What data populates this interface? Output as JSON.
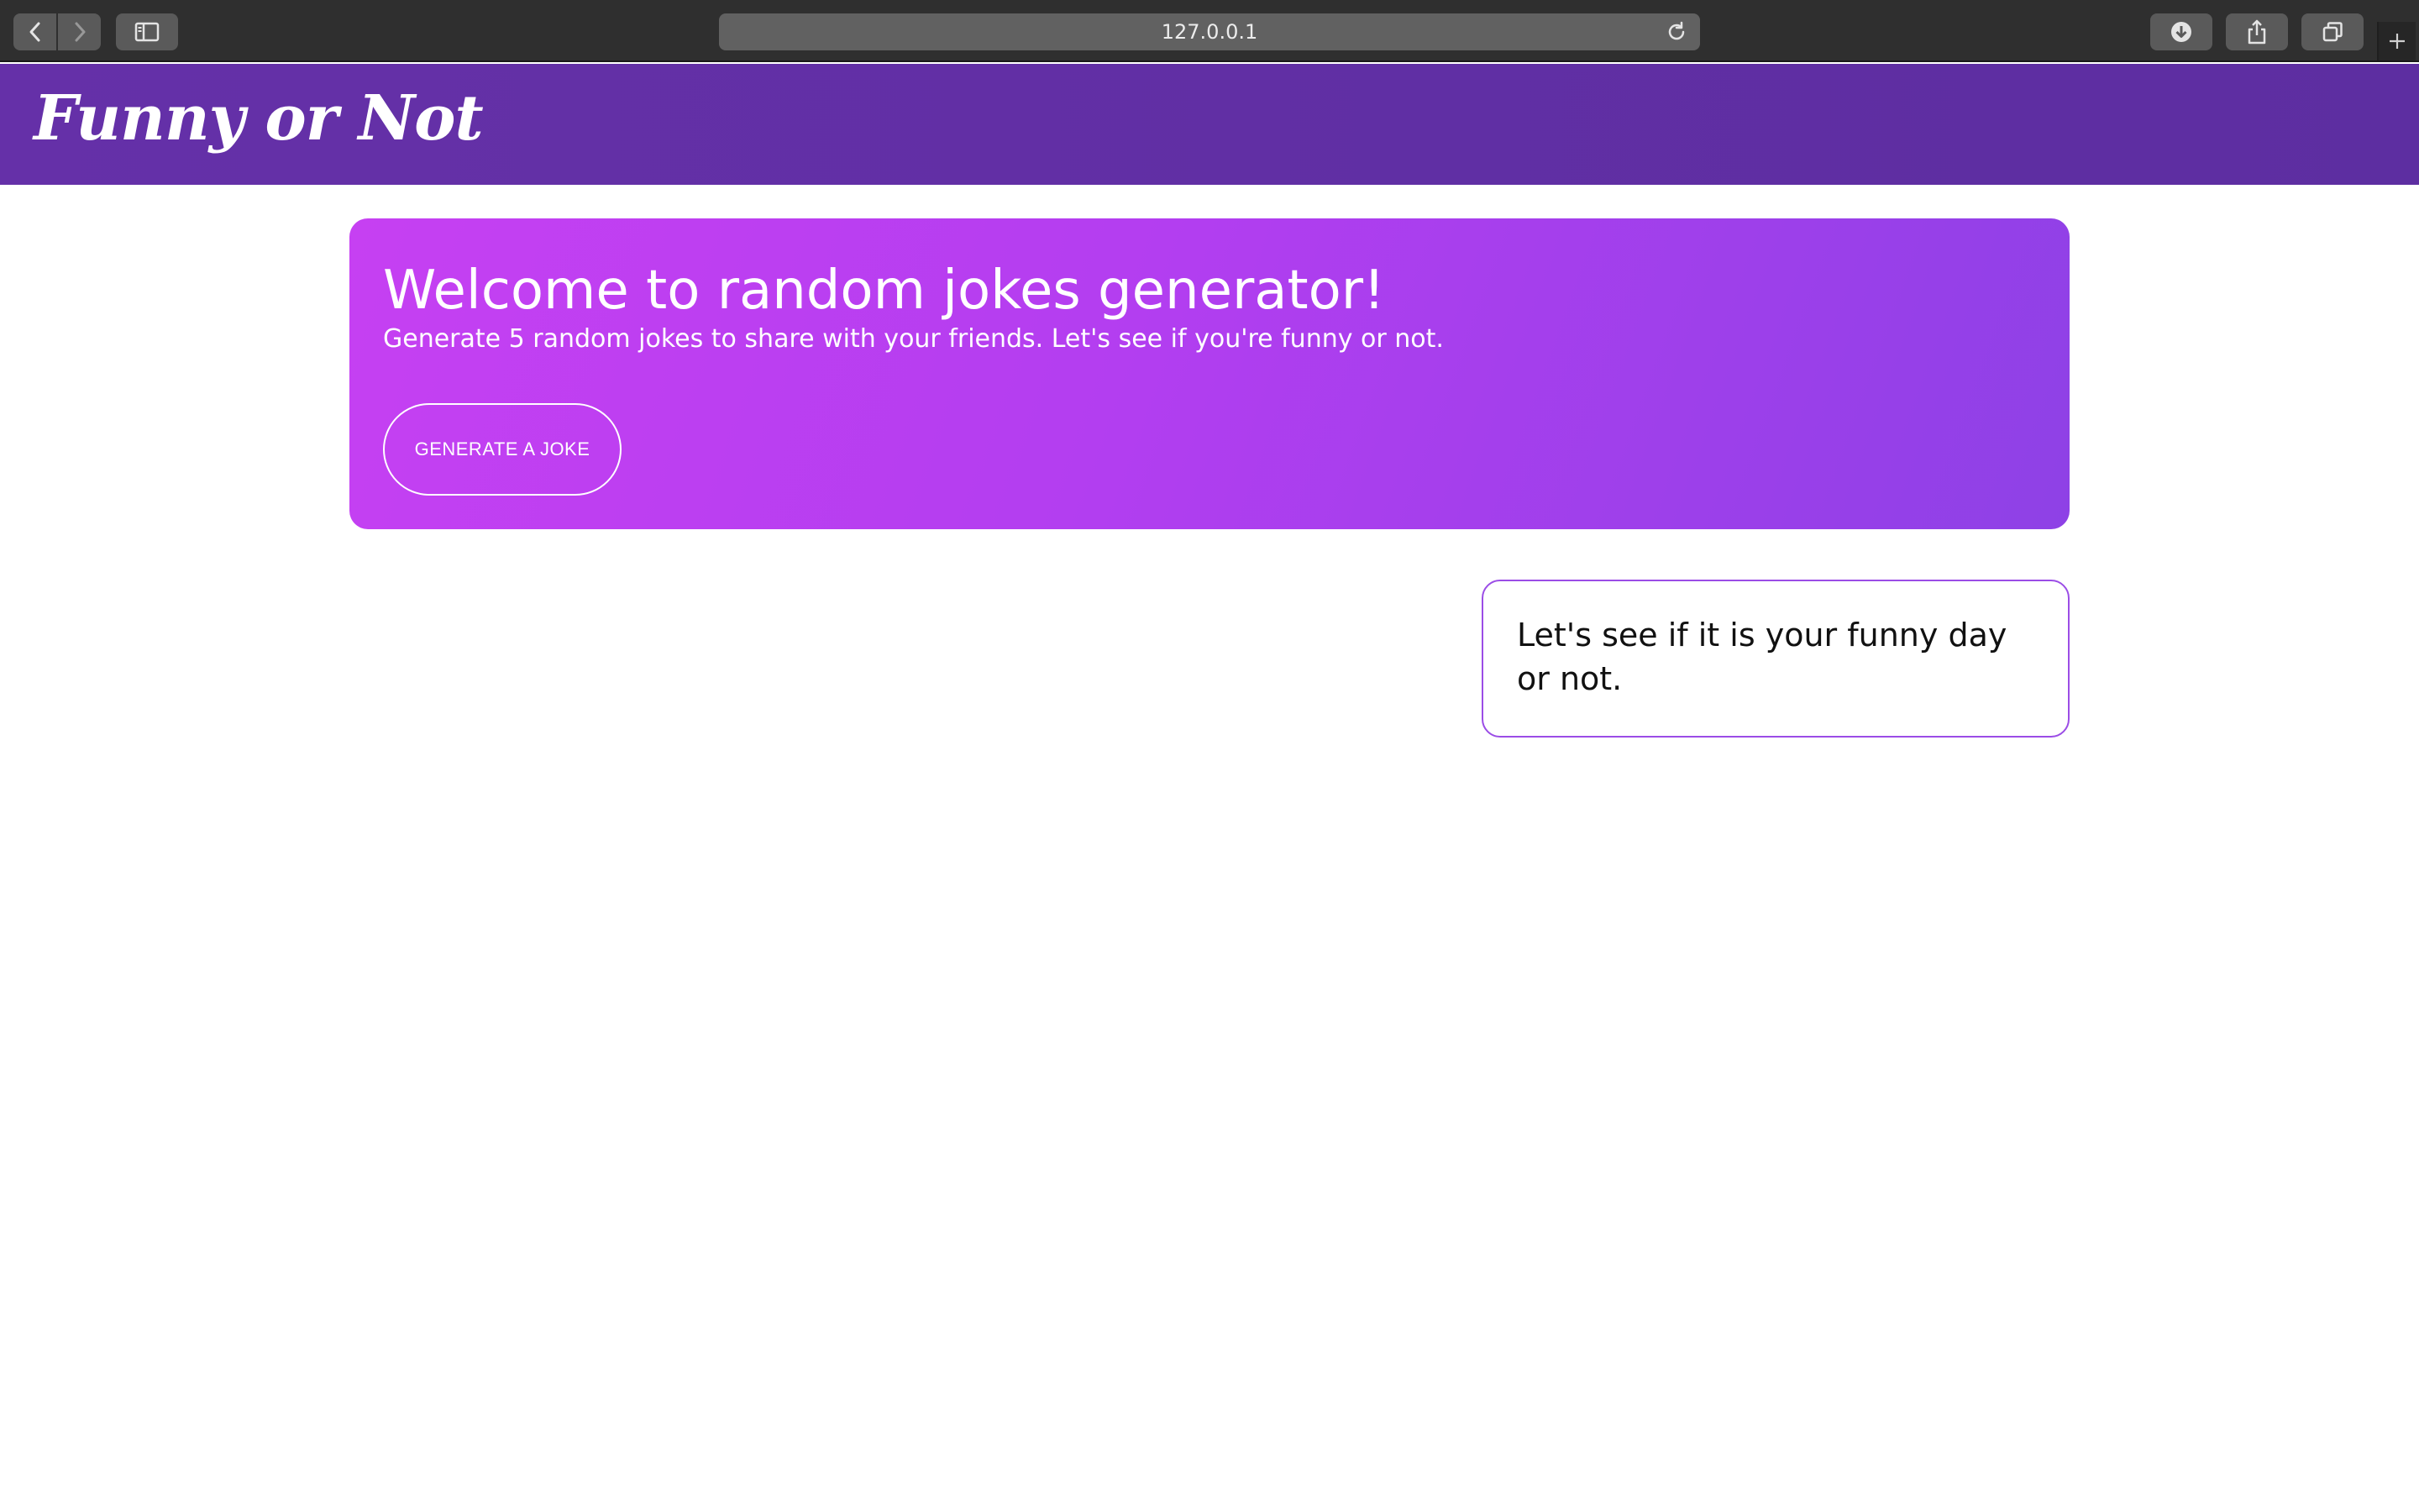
{
  "browser": {
    "url": "127.0.0.1",
    "icons": {
      "back": "chevron-left-icon",
      "forward": "chevron-right-icon",
      "sidebar": "sidebar-icon",
      "reload": "reload-icon",
      "downloads": "download-icon",
      "share": "share-icon",
      "tabs": "tabs-overview-icon",
      "new_tab": "plus-icon"
    }
  },
  "header": {
    "brand": "Funny or Not",
    "background_color": "#6530a8"
  },
  "hero": {
    "title": "Welcome to random jokes generator!",
    "subtitle": "Generate 5 random jokes to share with your friends. Let's see if you're funny or not.",
    "button_label": "GENERATE A JOKE",
    "gradient_start": "#c640f2",
    "gradient_end": "#8e41e6"
  },
  "joke": {
    "text": "Let's see if it is your funny day or not.",
    "border_color": "#9b4de6"
  }
}
